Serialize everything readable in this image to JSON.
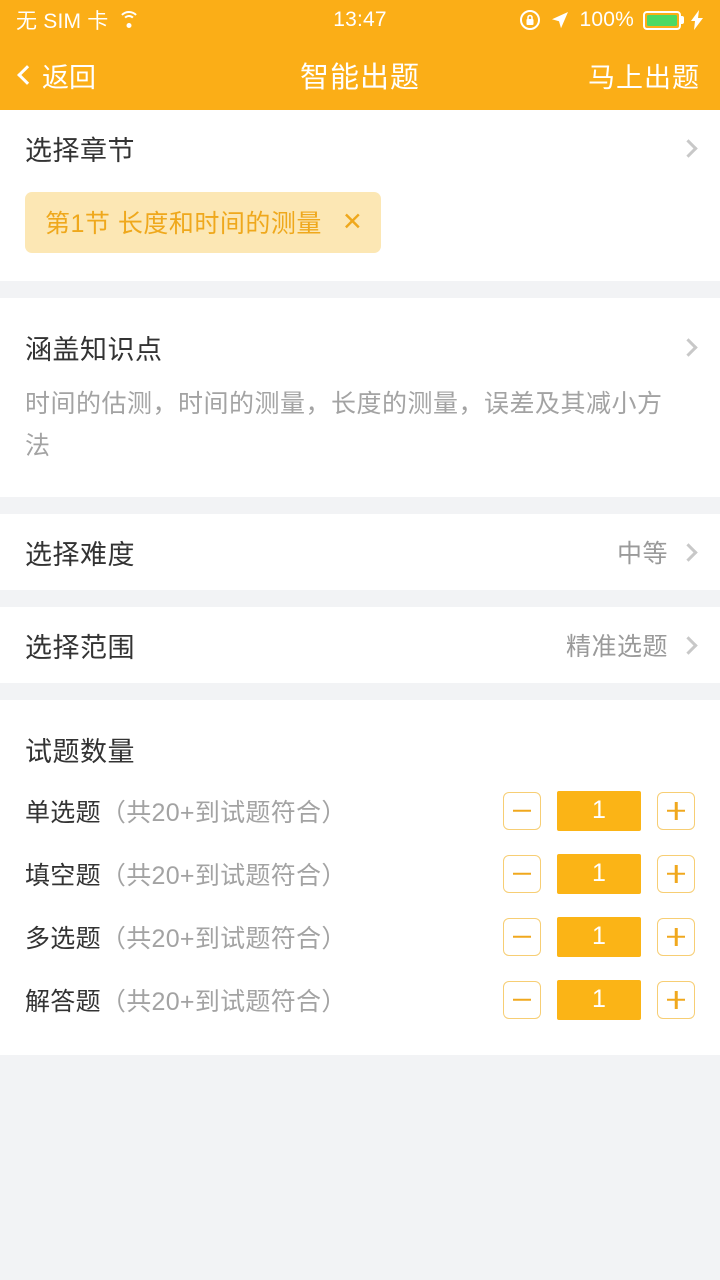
{
  "status_bar": {
    "carrier": "无 SIM 卡",
    "wifi_icon": "wifi-icon",
    "time": "13:47",
    "rotation_lock_icon": "rotation-lock-icon",
    "location_icon": "location-arrow-icon",
    "battery_percent": "100%",
    "charging_icon": "lightning-bolt-icon"
  },
  "nav": {
    "back_label": "返回",
    "back_icon": "chevron-left-icon",
    "title": "智能出题",
    "action_label": "马上出题"
  },
  "chapter": {
    "title": "选择章节",
    "chevron_icon": "chevron-right-icon",
    "chips": [
      {
        "label": "第1节 长度和时间的测量",
        "remove_icon": "close-icon"
      }
    ]
  },
  "knowledge": {
    "title": "涵盖知识点",
    "chevron_icon": "chevron-right-icon",
    "description": "时间的估测，时间的测量，长度的测量，误差及其减小方法"
  },
  "difficulty": {
    "title": "选择难度",
    "value": "中等",
    "chevron_icon": "chevron-right-icon"
  },
  "scope": {
    "title": "选择范围",
    "value": "精准选题",
    "chevron_icon": "chevron-right-icon"
  },
  "question_counts": {
    "title": "试题数量",
    "minus_icon": "minus-icon",
    "plus_icon": "plus-icon",
    "rows": [
      {
        "name": "单选题",
        "note": "（共20+到试题符合）",
        "value": "1"
      },
      {
        "name": "填空题",
        "note": "（共20+到试题符合）",
        "value": "1"
      },
      {
        "name": "多选题",
        "note": "（共20+到试题符合）",
        "value": "1"
      },
      {
        "name": "解答题",
        "note": "（共20+到试题符合）",
        "value": "1"
      }
    ]
  },
  "colors": {
    "brand_orange": "#FBAE17",
    "chip_bg": "#FCE7B4",
    "chip_text": "#EFA81C",
    "page_bg": "#F2F3F5",
    "battery_green": "#4CD964"
  }
}
